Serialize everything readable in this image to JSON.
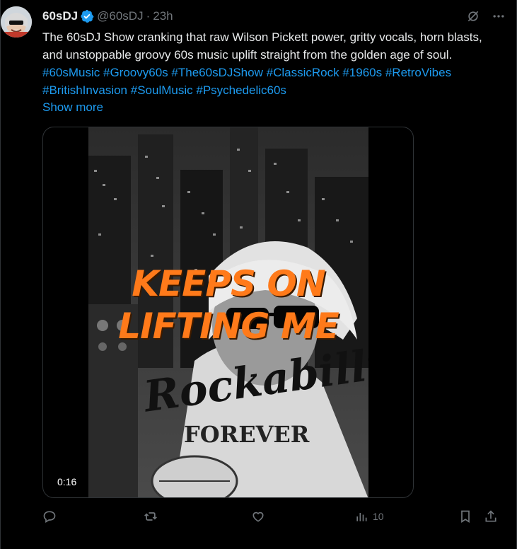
{
  "author": {
    "display_name": "60sDJ",
    "handle": "@60sDJ",
    "separator": "·",
    "time": "23h",
    "verified": true
  },
  "tweet": {
    "text": "The 60sDJ Show cranking that raw Wilson Pickett power, gritty vocals, horn blasts, and unstoppable groovy 60s music uplift straight from the golden age of soul. ",
    "hashtags": [
      "#60sMusic",
      "#Groovy60s",
      "#The60sDJShow",
      "#ClassicRock",
      "#1960s",
      "#RetroVibes",
      "#BritishInvasion",
      "#SoulMusic",
      "#Psychedelic60s"
    ],
    "show_more": "Show more"
  },
  "media": {
    "overlay_line1": "KEEPS ON",
    "overlay_line2": "LIFTING ME",
    "shirt_word1": "Rockabilly",
    "shirt_word2": "FOREVER",
    "duration": "0:16"
  },
  "actions": {
    "views": "10"
  },
  "icons": {
    "grok": "grok-icon",
    "more": "more-icon",
    "reply": "reply-icon",
    "repost": "repost-icon",
    "like": "like-icon",
    "views": "views-icon",
    "bookmark": "bookmark-icon",
    "share": "share-icon"
  },
  "colors": {
    "background": "#000000",
    "text": "#e7e9ea",
    "muted": "#71767b",
    "link": "#1d9bf0",
    "overlay": "#ff7a1a"
  }
}
